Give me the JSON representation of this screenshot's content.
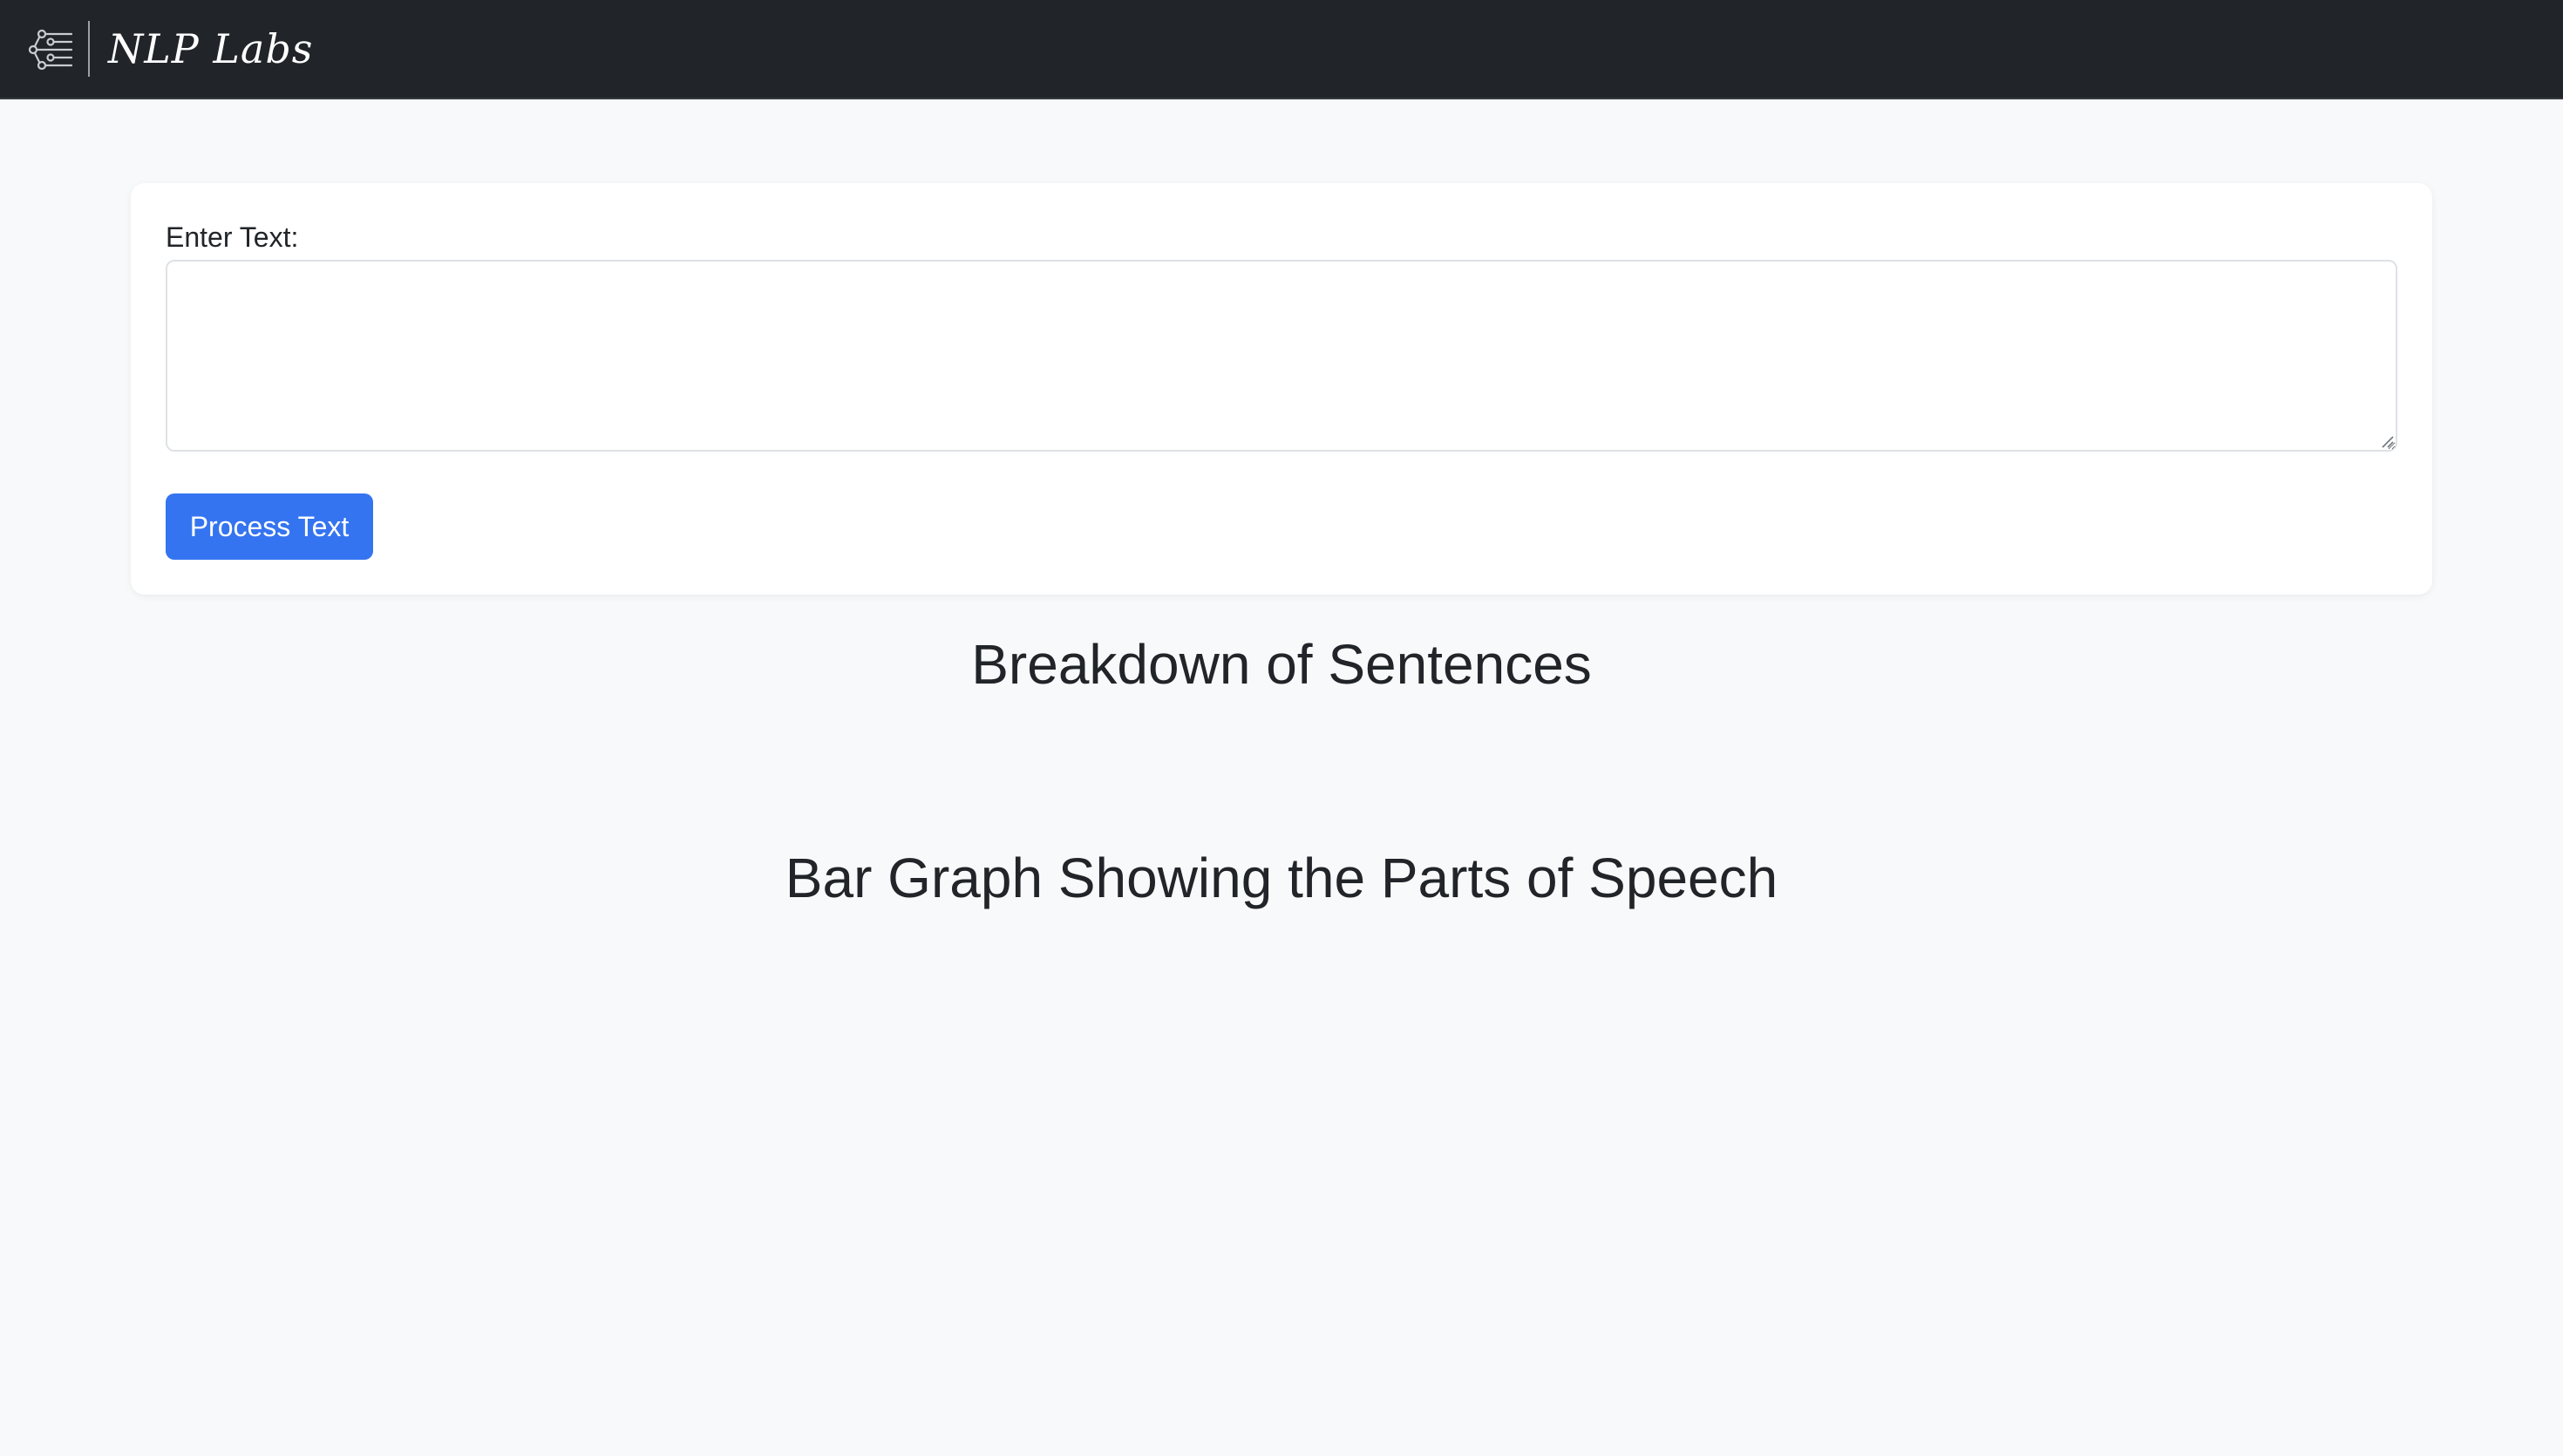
{
  "navbar": {
    "brand": "NLP Labs",
    "logo_icon": "neural-network-icon",
    "background": "#212529"
  },
  "form": {
    "label": "Enter Text:",
    "textarea_value": "",
    "textarea_placeholder": "",
    "submit_label": "Process Text",
    "submit_color": "#3574f0"
  },
  "sections": {
    "sentences_heading": "Breakdown of Sentences",
    "bargraph_heading": "Bar Graph Showing the Parts of Speech"
  },
  "colors": {
    "page_background": "#f8f9fa",
    "card_background": "#ffffff",
    "text": "#212529"
  }
}
